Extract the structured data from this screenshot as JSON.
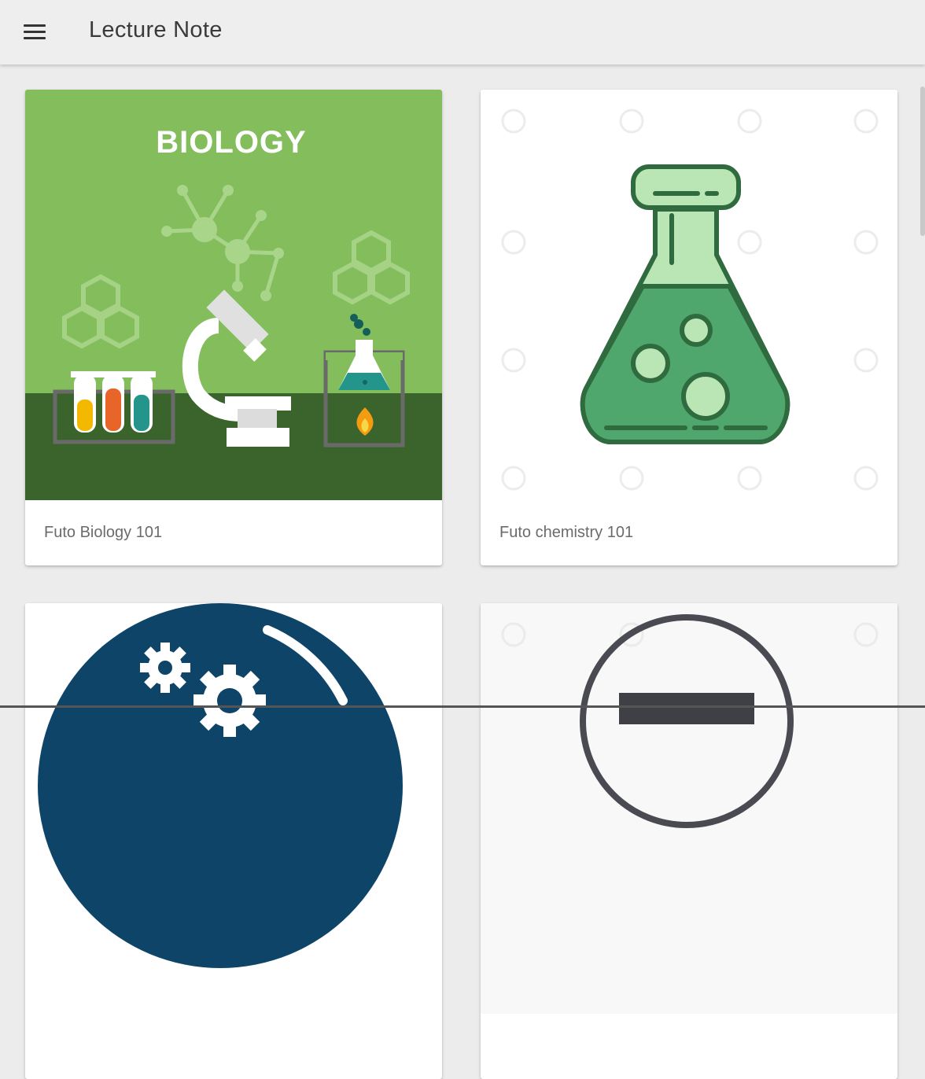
{
  "app_bar": {
    "title": "Lecture Note",
    "menu_icon": "hamburger-menu-icon"
  },
  "courses": [
    {
      "title": "Futo Biology 101",
      "image_label": "BIOLOGY",
      "image": "biology-illustration"
    },
    {
      "title": "Futo chemistry 101",
      "image": "erlenmeyer-flask-illustration"
    },
    {
      "title": "",
      "image": "gears-circle-logo"
    },
    {
      "title": "",
      "image": "circle-emblem-logo"
    }
  ],
  "colors": {
    "app_bar": "#eeeeee",
    "background": "#ececec",
    "biology_green": "#84bd5c",
    "biology_dark_green": "#3b642d",
    "flask_green": "#4fa76d",
    "navy": "#0e4468"
  }
}
